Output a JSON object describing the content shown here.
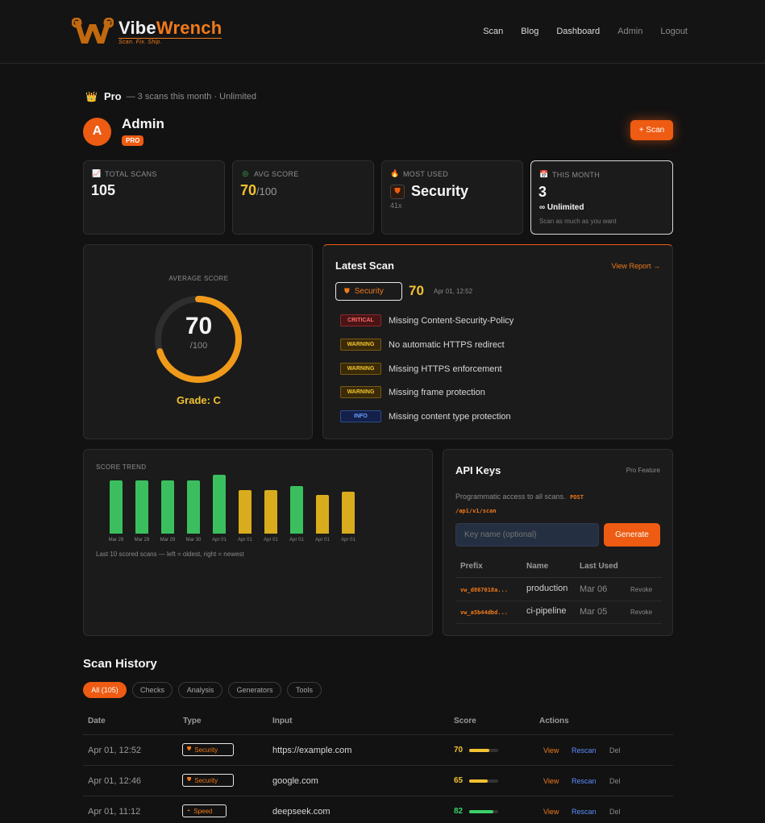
{
  "brand": {
    "name_a": "Vibe",
    "name_b": "Wrench",
    "tagline": "Scan. Fix. Ship."
  },
  "nav": [
    "Scan",
    "Blog",
    "Dashboard",
    "Admin",
    "Logout"
  ],
  "plan": {
    "name": "Pro",
    "detail": "— 3 scans this month · Unlimited"
  },
  "user": {
    "initial": "A",
    "name": "Admin",
    "badge": "PRO"
  },
  "scan_button": "+ Scan",
  "stats": {
    "total": {
      "label": "TOTAL SCANS",
      "value": "105"
    },
    "avg": {
      "label": "AVG SCORE",
      "value": "70",
      "suffix": "/100"
    },
    "most": {
      "label": "MOST USED",
      "value": "Security",
      "sub": "41x"
    },
    "month": {
      "label": "THIS MONTH",
      "value": "3",
      "limit": "∞ Unlimited",
      "note": "Scan as much as you want"
    }
  },
  "average": {
    "label": "AVERAGE SCORE",
    "score": "70",
    "out_of": "/100",
    "fraction": 0.7,
    "grade": "Grade: C"
  },
  "latest": {
    "title": "Latest Scan",
    "link": "View Report →",
    "type": "Security",
    "score": "70",
    "time": "Apr 01, 12:52",
    "issues": [
      {
        "severity": "CRITICAL",
        "text": "Missing Content-Security-Policy"
      },
      {
        "severity": "WARNING",
        "text": "No automatic HTTPS redirect"
      },
      {
        "severity": "WARNING",
        "text": "Missing HTTPS enforcement"
      },
      {
        "severity": "WARNING",
        "text": "Missing frame protection"
      },
      {
        "severity": "INFO",
        "text": "Missing content type protection"
      }
    ]
  },
  "trend": {
    "label": "SCORE TREND",
    "caption": "Last 10 scored scans — left = oldest, right = newest"
  },
  "chart_data": {
    "type": "bar",
    "categories": [
      "Mar 29",
      "Mar 29",
      "Mar 29",
      "Mar 30",
      "Apr 01",
      "Apr 01",
      "Apr 01",
      "Apr 01",
      "Apr 01",
      "Apr 01"
    ],
    "values": [
      82,
      82,
      82,
      82,
      91,
      68,
      68,
      74,
      60,
      65
    ],
    "colors": [
      "#3bbf5e",
      "#3bbf5e",
      "#3bbf5e",
      "#3bbf5e",
      "#3bbf5e",
      "#d8ac1c",
      "#d8ac1c",
      "#3bbf5e",
      "#d8ac1c",
      "#d8ac1c"
    ],
    "ylim": [
      0,
      100
    ]
  },
  "api": {
    "title": "API Keys",
    "feature": "Pro Feature",
    "desc": "Programmatic access to all scans.",
    "method": "POST",
    "endpoint": "/api/v1/scan",
    "placeholder": "Key name (optional)",
    "generate": "Generate",
    "headers": [
      "Prefix",
      "Name",
      "Last Used"
    ],
    "keys": [
      {
        "prefix": "vw_d867018a...",
        "name": "production",
        "last": "Mar 06",
        "action": "Revoke"
      },
      {
        "prefix": "vw_a5b44dbd...",
        "name": "ci-pipeline",
        "last": "Mar 05",
        "action": "Revoke"
      }
    ]
  },
  "history": {
    "title": "Scan History",
    "filters": [
      "All (105)",
      "Checks",
      "Analysis",
      "Generators",
      "Tools"
    ],
    "headers": [
      "Date",
      "Type",
      "Input",
      "Score",
      "Actions"
    ],
    "actions": [
      "View",
      "Rescan",
      "Del"
    ],
    "rows": [
      {
        "date": "Apr 01, 12:52",
        "type": "Security",
        "icon": "shield-icon",
        "input": "https://example.com",
        "score": "70",
        "fraction": 0.7,
        "color": "#f2c230"
      },
      {
        "date": "Apr 01, 12:46",
        "type": "Security",
        "icon": "shield-icon",
        "input": "google.com",
        "score": "65",
        "fraction": 0.65,
        "color": "#f2c230"
      },
      {
        "date": "Apr 01, 11:12",
        "type": "Speed",
        "icon": "speedometer-icon",
        "input": "deepseek.com",
        "score": "82",
        "fraction": 0.82,
        "color": "#3bd16a"
      }
    ]
  },
  "colors": {
    "accent": "#ee5b12",
    "warn": "#f2c230",
    "good": "#3bbf5e"
  }
}
